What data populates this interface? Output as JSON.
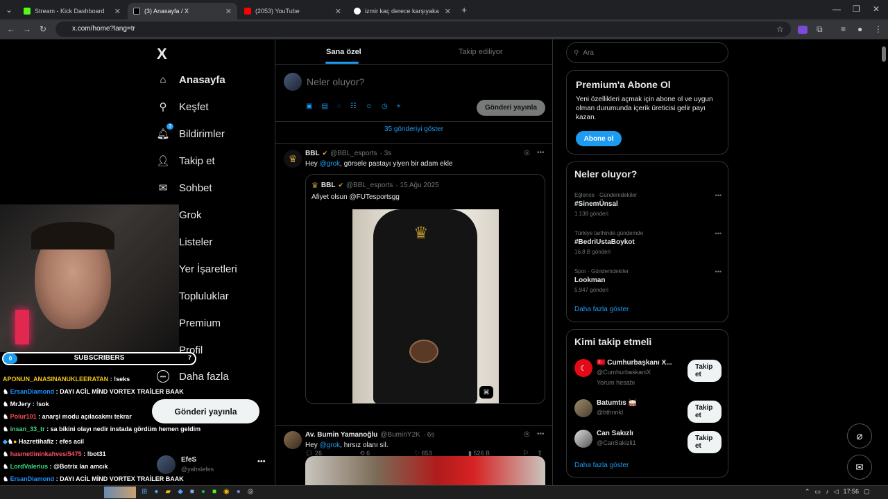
{
  "browser": {
    "tabs": [
      {
        "title": "Stream - Kick Dashboard",
        "color": "#53fc18"
      },
      {
        "title": "(3) Anasayfa / X",
        "color": "#ffffff"
      },
      {
        "title": "(2053) YouTube",
        "color": "#ff0000"
      },
      {
        "title": "izmir kaç derece karşıyaka - Goo",
        "color": "#4285f4"
      }
    ],
    "url": "x.com/home?lang=tr"
  },
  "sidebar": {
    "logo": "X",
    "items": [
      {
        "label": "Anasayfa",
        "icon": "home-icon"
      },
      {
        "label": "Keşfet",
        "icon": "search-icon"
      },
      {
        "label": "Bildirimler",
        "icon": "bell-icon",
        "badge": "3"
      },
      {
        "label": "Takip et",
        "icon": "user-plus-icon"
      },
      {
        "label": "Sohbet",
        "icon": "mail-icon"
      },
      {
        "label": "Grok",
        "icon": "grok-icon"
      },
      {
        "label": "Listeler",
        "icon": "list-icon"
      },
      {
        "label": "Yer İşaretleri",
        "icon": "bookmark-icon"
      },
      {
        "label": "Topluluklar",
        "icon": "people-icon"
      },
      {
        "label": "Premium",
        "icon": "x-icon"
      },
      {
        "label": "Profil",
        "icon": "profile-icon"
      },
      {
        "label": "Daha fazla",
        "icon": "more-icon"
      }
    ],
    "post_button": "Gönderi yayınla",
    "account": {
      "name": "EfeS",
      "handle": "@yahslefes"
    }
  },
  "feed": {
    "tabs": [
      "Sana özel",
      "Takip ediliyor"
    ],
    "composer": {
      "placeholder": "Neler oluyor?",
      "button": "Gönderi yayınla"
    },
    "show_new": "35 gönderiyi göster",
    "tweets": [
      {
        "name": "BBL",
        "handle": "@BBL_esports",
        "time": "· 3s",
        "text_pre": "Hey ",
        "mention": "@grok",
        "text_post": ", görsele pastayı yiyen bir adam ekle",
        "quote": {
          "name": "BBL",
          "handle": "@BBL_esports",
          "time": "· 15 Ağu 2025",
          "text": "Afiyet olsun @FUTesportsgg"
        },
        "stats": {
          "replies": "26",
          "reposts": "6",
          "likes": "653",
          "views": "526 B"
        }
      },
      {
        "name": "Av. Bumin Yamanoğlu",
        "handle": "@BuminY2K",
        "time": "· 6s",
        "text_pre": "Hey ",
        "mention": "@grok",
        "text_post": ", hırsız olanı sil."
      }
    ]
  },
  "right": {
    "search_placeholder": "Ara",
    "premium": {
      "title": "Premium'a Abone Ol",
      "body": "Yeni özellikleri açmak için abone ol ve uygun olman durumunda içerik üreticisi gelir payı kazan.",
      "button": "Abone ol"
    },
    "trends": {
      "title": "Neler oluyor?",
      "items": [
        {
          "category": "Eğlence · Gündemdekiler",
          "name": "#SinemÜnsal",
          "count": "1.138 gönderi"
        },
        {
          "category": "Türkiye tarihinde gündemde",
          "name": "#BedriUstaBoykot",
          "count": "16,8 B gönderi"
        },
        {
          "category": "Spor · Gündemdekiler",
          "name": "Lookman",
          "count": "5.947 gönderi"
        }
      ],
      "more": "Daha fazla göster"
    },
    "who_to_follow": {
      "title": "Kimi takip etmeli",
      "items": [
        {
          "name": "🇹🇷 Cumhurbaşkanı X...",
          "handle": "@CumhurbaskaniX",
          "sub": "Yorum hesabı",
          "button": "Takip et"
        },
        {
          "name": "Batumtıs 🥁",
          "handle": "@bthnnkl",
          "button": "Takip et"
        },
        {
          "name": "Can Sakızlı",
          "handle": "@CanSakizli1",
          "button": "Takip et"
        }
      ],
      "more": "Daha fazla göster"
    }
  },
  "overlay": {
    "subs_label": "SUBSCRIBERS",
    "subs_left": "0",
    "subs_right": "7",
    "chat": [
      {
        "user": "APONUN_ANASINANUKLEERATAN",
        "msg": " : !seks",
        "color": "#f5c518"
      },
      {
        "user": "ErsanDiamond",
        "msg": " : DAYI ACİL MİND VORTEX TRAİLER BAAK",
        "color": "#1e90ff"
      },
      {
        "user": "MrJery",
        "msg": " : !sok",
        "color": "#ffffff"
      },
      {
        "user": "Polur101",
        "msg": " : anarşi modu açılacakmı tekrar",
        "color": "#ff4d4d"
      },
      {
        "user": "insan_33_tr",
        "msg": " : sa bikini olayı nedir instada gördüm hemen geldim",
        "color": "#3ddc84"
      },
      {
        "user": "Hazretihafiz",
        "msg": " : efes acil",
        "color": "#ffffff"
      },
      {
        "user": "hasmetlininkahvesi5475",
        "msg": " : !bot31",
        "color": "#ff4d6d"
      },
      {
        "user": "LordValerius",
        "msg": " : @Botrix lan amcık",
        "color": "#3ddc84"
      },
      {
        "user": "ErsanDiamond",
        "msg": " : DAYI ACİL MİND VORTEX TRAİLER BAAK",
        "color": "#1e90ff"
      }
    ]
  },
  "taskbar": {
    "time": "17:56"
  }
}
